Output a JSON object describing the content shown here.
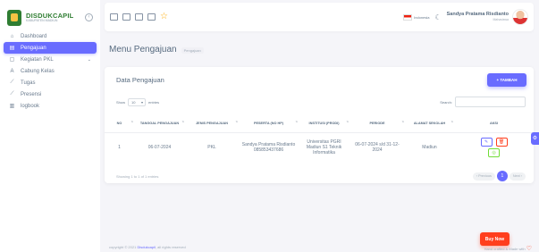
{
  "brand": {
    "name": "DISDUKCAPIL",
    "sub": "KABUPATEN MADIUN"
  },
  "sidebar": {
    "items": [
      {
        "label": "Dashboard",
        "icon": "home-icon"
      },
      {
        "label": "Pengajuan",
        "icon": "file-icon",
        "active": true
      },
      {
        "label": "Kegiatan PKL",
        "icon": "clipboard-icon",
        "has_caret": true
      },
      {
        "label": "Cabung Kelas",
        "icon": "user-icon"
      },
      {
        "label": "Tugas",
        "icon": "pin-icon"
      },
      {
        "label": "Presensi",
        "icon": "pin-icon"
      },
      {
        "label": "logbook",
        "icon": "book-icon"
      }
    ]
  },
  "navbar": {
    "language": "Indonesia",
    "user_name": "Sandya Pratama Risdianto",
    "user_role": "Mahasiswa"
  },
  "page": {
    "title": "Menu Pengajuan",
    "breadcrumb": "Pengajuan"
  },
  "card": {
    "title": "Data Pengajuan",
    "add_label": "+ TAMBAH",
    "show_label": "Show",
    "entries_value": "10",
    "entries_label": "entries",
    "search_label": "Search:",
    "info": "Showing 1 to 1 of 1 entries",
    "prev_label": "‹ Previous",
    "page_number": "1",
    "next_label": "Next ›"
  },
  "table": {
    "headers": [
      "NO",
      "TANGGAL PENGAJUAN",
      "JENIS PENGAJUAN",
      "PESERTA (NO HP)",
      "INSTITUSI (PRODI)",
      "PERIODE",
      "ALAMAT SEKOLAH",
      "AKSI"
    ],
    "rows": [
      {
        "no": "1",
        "tanggal": "06-07-2024",
        "jenis": "PKL",
        "peserta": "Sandya Pratama Risdianto 085853437686",
        "institusi": "Universitas PGRI Madiun S1 Teknik Informatika",
        "periode": "06-07-2024 s/d 31-12-2024",
        "alamat": "Madiun"
      }
    ]
  },
  "footer": {
    "copyright_prefix": "copyright © 2021",
    "copyright_link": "Disdukcapil",
    "copyright_suffix": ", all rights reserved",
    "buy_now": "Buy Now",
    "made_with": "Hand crafted & Made with"
  },
  "colors": {
    "accent": "#696cff",
    "danger": "#ff3e1d",
    "success": "#71dd37",
    "brand_green": "#2f7d32"
  }
}
